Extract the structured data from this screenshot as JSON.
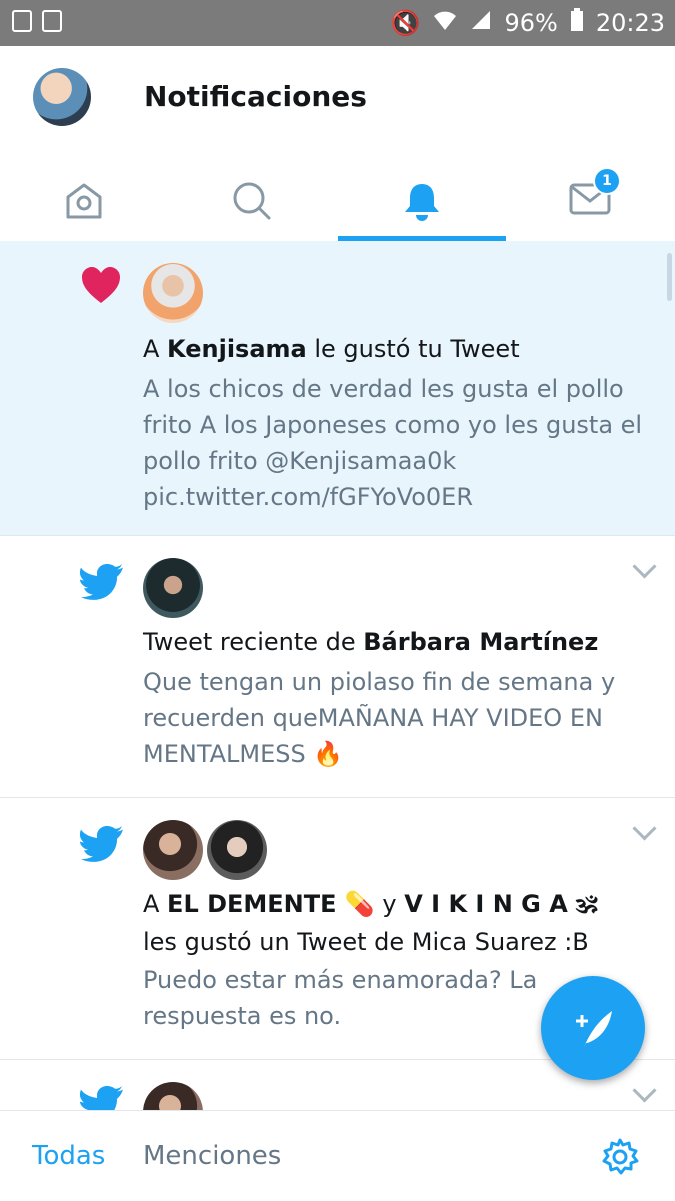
{
  "statusbar": {
    "battery": "96%",
    "time": "20:23"
  },
  "header": {
    "title": "Notificaciones"
  },
  "tabs": [
    {
      "name": "home",
      "icon": "home-icon"
    },
    {
      "name": "search",
      "icon": "search-icon"
    },
    {
      "name": "notifications",
      "icon": "bell-icon"
    },
    {
      "name": "messages",
      "icon": "mail-icon",
      "badge": "1"
    }
  ],
  "notifications": [
    {
      "type": "like",
      "prefix": "A ",
      "user": "Kenjisama",
      "suffix": " le gustó tu Tweet",
      "text": "A los chicos de verdad les gusta el pollo frito A los Japoneses como yo les gusta el pollo frito @Kenjisamaa0k pic.twitter.com/fGFYoVo0ER"
    },
    {
      "type": "tweet",
      "prefix": "Tweet reciente de ",
      "user": "Bárbara Martínez",
      "text": "Que tengan un piolaso fin de semana y recuerden queMAÑANA HAY VIDEO EN MENTALMESS 🔥"
    },
    {
      "type": "tweet",
      "prefix": "A ",
      "user1": "EL DEMENTE 💊",
      "mid": " y ",
      "user2": "V I K I N G A 🕉",
      "line2": "les gustó un Tweet de Mica Suarez :B",
      "text": "Puedo estar más enamorada? La respuesta es no."
    }
  ],
  "bottom": {
    "all": "Todas",
    "mentions": "Menciones"
  },
  "colors": {
    "accent": "#1da1f2",
    "like": "#e0245e",
    "highlight": "#e8f5fd"
  }
}
